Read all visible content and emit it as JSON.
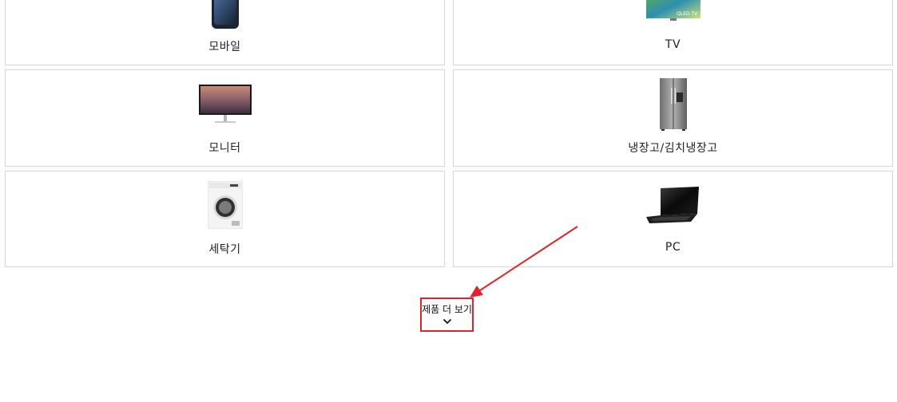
{
  "products": {
    "mobile": {
      "label": "모바일",
      "image_icon": "smartphone-icon"
    },
    "tv": {
      "label": "TV",
      "image_icon": "qled-tv-icon"
    },
    "monitor": {
      "label": "모니터",
      "image_icon": "monitor-icon"
    },
    "fridge": {
      "label": "냉장고/김치냉장고",
      "image_icon": "refrigerator-icon"
    },
    "washer": {
      "label": "세탁기",
      "image_icon": "washing-machine-icon"
    },
    "pc": {
      "label": "PC",
      "image_icon": "laptop-icon"
    }
  },
  "more_button": {
    "label": "제품 더 보기",
    "icon": "chevron-down-icon"
  },
  "tv_screen_badge": "QLED TV",
  "colors": {
    "card_border": "#d6d6d6",
    "annotation_red": "#e1242c"
  }
}
